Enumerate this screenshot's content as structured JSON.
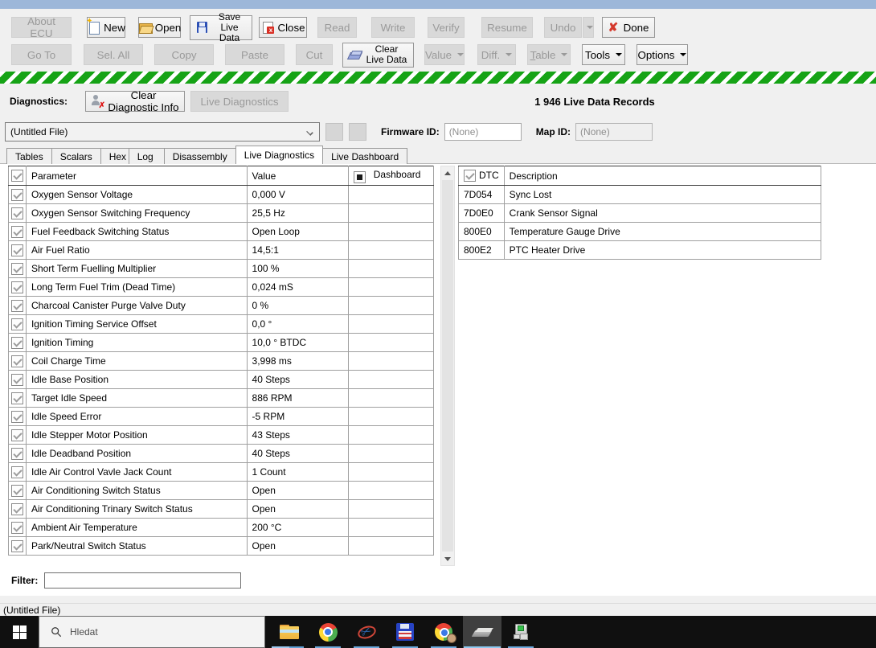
{
  "toolbar": {
    "row1": [
      {
        "label": "About ECU",
        "enabled": false
      },
      {
        "label": "New",
        "enabled": true
      },
      {
        "label": "Open",
        "enabled": true
      },
      {
        "label": "Save Live Data",
        "enabled": true
      },
      {
        "label": "Close",
        "enabled": true
      },
      {
        "label": "Read",
        "enabled": false
      },
      {
        "label": "Write",
        "enabled": false
      },
      {
        "label": "Verify",
        "enabled": false
      },
      {
        "label": "Resume",
        "enabled": false
      },
      {
        "label": "Undo",
        "enabled": false
      },
      {
        "label": "Done",
        "enabled": true
      }
    ],
    "row2": [
      {
        "label": "Go To",
        "enabled": false
      },
      {
        "label": "Sel. All",
        "enabled": false
      },
      {
        "label": "Copy",
        "enabled": false
      },
      {
        "label": "Paste",
        "enabled": false
      },
      {
        "label": "Cut",
        "enabled": false
      },
      {
        "label": "Clear Live Data",
        "enabled": true
      },
      {
        "label": "Value",
        "enabled": false
      },
      {
        "label": "Diff.",
        "enabled": false
      },
      {
        "label": "Table",
        "enabled": false
      },
      {
        "label": "Tools",
        "enabled": true
      },
      {
        "label": "Options",
        "enabled": true
      }
    ]
  },
  "diagnostics": {
    "label": "Diagnostics:",
    "clear_button": "Clear Diagnostic Info",
    "live_button": "Live Diagnostics",
    "records": "1 946 Live Data Records"
  },
  "file_row": {
    "file_select": "(Untitled File)",
    "firmware_label": "Firmware ID:",
    "firmware_value": "(None)",
    "map_label": "Map ID:",
    "map_value": "(None)"
  },
  "tabs": [
    {
      "label": "Tables"
    },
    {
      "label": "Scalars"
    },
    {
      "label": "Hex"
    },
    {
      "label": "Log"
    },
    {
      "label": "Disassembly"
    },
    {
      "label": "Live Diagnostics"
    },
    {
      "label": "Live Dashboard"
    }
  ],
  "live_table": {
    "headers": {
      "parameter": "Parameter",
      "value": "Value",
      "dashboard": "Dashboard"
    },
    "rows": [
      {
        "name": "Oxygen Sensor Voltage",
        "value": "0,000 V"
      },
      {
        "name": "Oxygen Sensor Switching Frequency",
        "value": "25,5 Hz"
      },
      {
        "name": "Fuel Feedback Switching Status",
        "value": "Open Loop"
      },
      {
        "name": "Air Fuel Ratio",
        "value": "14,5:1"
      },
      {
        "name": "Short Term Fuelling Multiplier",
        "value": "100 %"
      },
      {
        "name": "Long Term Fuel Trim (Dead Time)",
        "value": "0,024 mS"
      },
      {
        "name": "Charcoal Canister Purge Valve Duty",
        "value": "0 %"
      },
      {
        "name": "Ignition Timing Service Offset",
        "value": "0,0 °"
      },
      {
        "name": "Ignition Timing",
        "value": "10,0 ° BTDC"
      },
      {
        "name": "Coil Charge Time",
        "value": "3,998 ms"
      },
      {
        "name": "Idle Base Position",
        "value": "40 Steps"
      },
      {
        "name": "Target Idle Speed",
        "value": "886 RPM"
      },
      {
        "name": "Idle Speed Error",
        "value": "-5 RPM"
      },
      {
        "name": "Idle Stepper Motor Position",
        "value": "43 Steps"
      },
      {
        "name": "Idle Deadband Position",
        "value": "40 Steps"
      },
      {
        "name": "Idle Air Control Vavle Jack Count",
        "value": "1 Count"
      },
      {
        "name": "Air Conditioning Switch Status",
        "value": "Open"
      },
      {
        "name": "Air Conditioning Trinary Switch Status",
        "value": "Open"
      },
      {
        "name": "Ambient Air Temperature",
        "value": "200 °C"
      },
      {
        "name": "Park/Neutral Switch Status",
        "value": "Open"
      }
    ]
  },
  "dtc_table": {
    "headers": {
      "dtc": "DTC",
      "description": "Description"
    },
    "rows": [
      {
        "code": "7D054",
        "desc": "Sync Lost"
      },
      {
        "code": "7D0E0",
        "desc": "Crank Sensor Signal"
      },
      {
        "code": "800E0",
        "desc": "Temperature Gauge Drive"
      },
      {
        "code": "800E2",
        "desc": "PTC Heater Drive"
      }
    ]
  },
  "filter": {
    "label": "Filter:",
    "value": ""
  },
  "status_bar": {
    "text": "(Untitled File)"
  },
  "taskbar": {
    "search_placeholder": "Hledat"
  },
  "colors": {
    "accent_green": "#16a316",
    "titlebar_blue": "#9db7d9",
    "taskbar_underline": "#6ca9dc"
  }
}
